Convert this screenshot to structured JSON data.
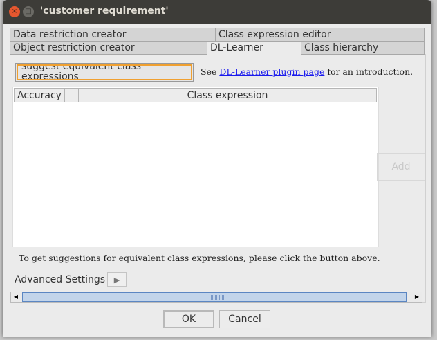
{
  "window": {
    "title": "'customer requirement'"
  },
  "tabs": {
    "row1": [
      "Data restriction creator",
      "Class expression editor"
    ],
    "row2": [
      "Object restriction creator",
      "DL-Learner",
      "Class hierarchy"
    ],
    "selected": "DL-Learner"
  },
  "dl_learner": {
    "suggest_button_line1": "suggest equivalent class",
    "suggest_button_line2": "expressions",
    "see_prefix": "See ",
    "link": "DL-Learner plugin page",
    "see_suffix": " for an introduction.",
    "columns": [
      "Accuracy",
      "",
      "Class expression"
    ],
    "add_label": "Add",
    "hint": "To get suggestions for equivalent class expressions, please click the button above.",
    "advanced_label": "Advanced Settings"
  },
  "buttons": {
    "ok": "OK",
    "cancel": "Cancel"
  }
}
